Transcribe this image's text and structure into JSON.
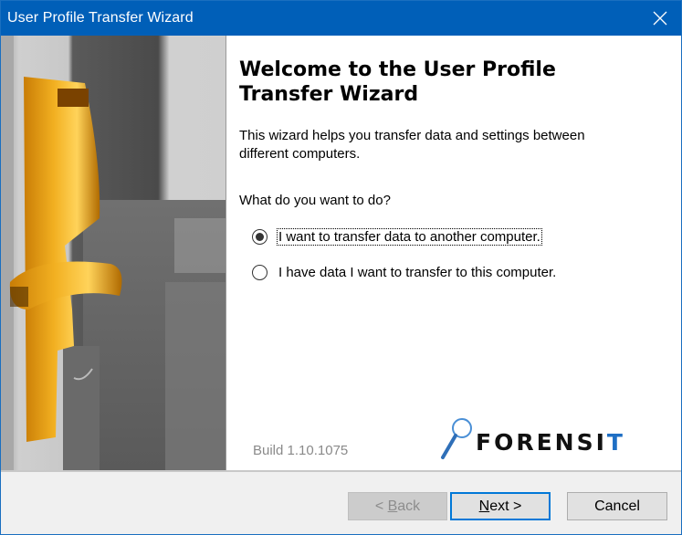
{
  "window": {
    "title": "User Profile Transfer Wizard",
    "close_icon": "close-icon"
  },
  "side_image": {
    "description": "gold hotel door handle with keycard slot",
    "accent_color": "#e8a317"
  },
  "content": {
    "heading": "Welcome to the User Profile Transfer Wizard",
    "description": "This wizard helps you transfer data and settings between different computers.",
    "question": "What do you want to do?",
    "options": [
      {
        "label": "I want to transfer data to another computer.",
        "selected": true
      },
      {
        "label": "I have data I want to transfer to this computer.",
        "selected": false
      }
    ],
    "build": "Build 1.10.1075",
    "logo": {
      "text_main": "FORENSI",
      "text_accent": "T",
      "icon": "magnifier-icon",
      "accent_color": "#1f6fc4"
    }
  },
  "footer": {
    "back_prefix": "< ",
    "back_mnemonic": "B",
    "back_rest": "ack",
    "back_enabled": false,
    "next_mnemonic": "N",
    "next_rest": "ext >",
    "cancel_label": "Cancel"
  }
}
